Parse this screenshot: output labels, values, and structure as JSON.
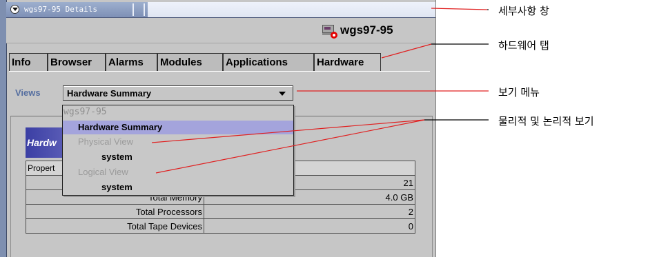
{
  "window": {
    "title": "wgs97-95 Details",
    "host_name": "wgs97-95"
  },
  "tabs": [
    {
      "label": "Info",
      "active": false
    },
    {
      "label": "Browser",
      "active": false
    },
    {
      "label": "Alarms",
      "active": false
    },
    {
      "label": "Modules",
      "active": false
    },
    {
      "label": "Applications",
      "active": false
    },
    {
      "label": "Hardware",
      "active": true
    }
  ],
  "views": {
    "label": "Views",
    "selected": "Hardware Summary",
    "options": [
      {
        "label": "wgs97-95",
        "level": 0
      },
      {
        "label": "Hardware Summary",
        "level": 1,
        "selected": true
      },
      {
        "label": "Physical View",
        "level": 1,
        "dim": true
      },
      {
        "label": "system",
        "level": 2
      },
      {
        "label": "Logical View",
        "level": 1,
        "dim": true
      },
      {
        "label": "system",
        "level": 2
      }
    ]
  },
  "panel": {
    "banner_text": "Hardw",
    "table_header": "Propert",
    "rows": [
      {
        "key": "",
        "value": "21"
      },
      {
        "key": "Total Memory",
        "value": "4.0 GB"
      },
      {
        "key": "Total Processors",
        "value": "2"
      },
      {
        "key": "Total Tape Devices",
        "value": "0"
      }
    ]
  },
  "callouts": {
    "details_window": "세부사항 창",
    "hardware_tab": "하드웨어 탭",
    "views_menu": "보기 메뉴",
    "physical_logical": "물리적 및 논리적 보기"
  },
  "colors": {
    "window_bg": "#c6c6c6",
    "title_bar": "#8497bd",
    "selection": "#a4a4dc",
    "views_label": "#566fa0",
    "callout_line": "#e02020",
    "banner": "#3b3fa4"
  }
}
